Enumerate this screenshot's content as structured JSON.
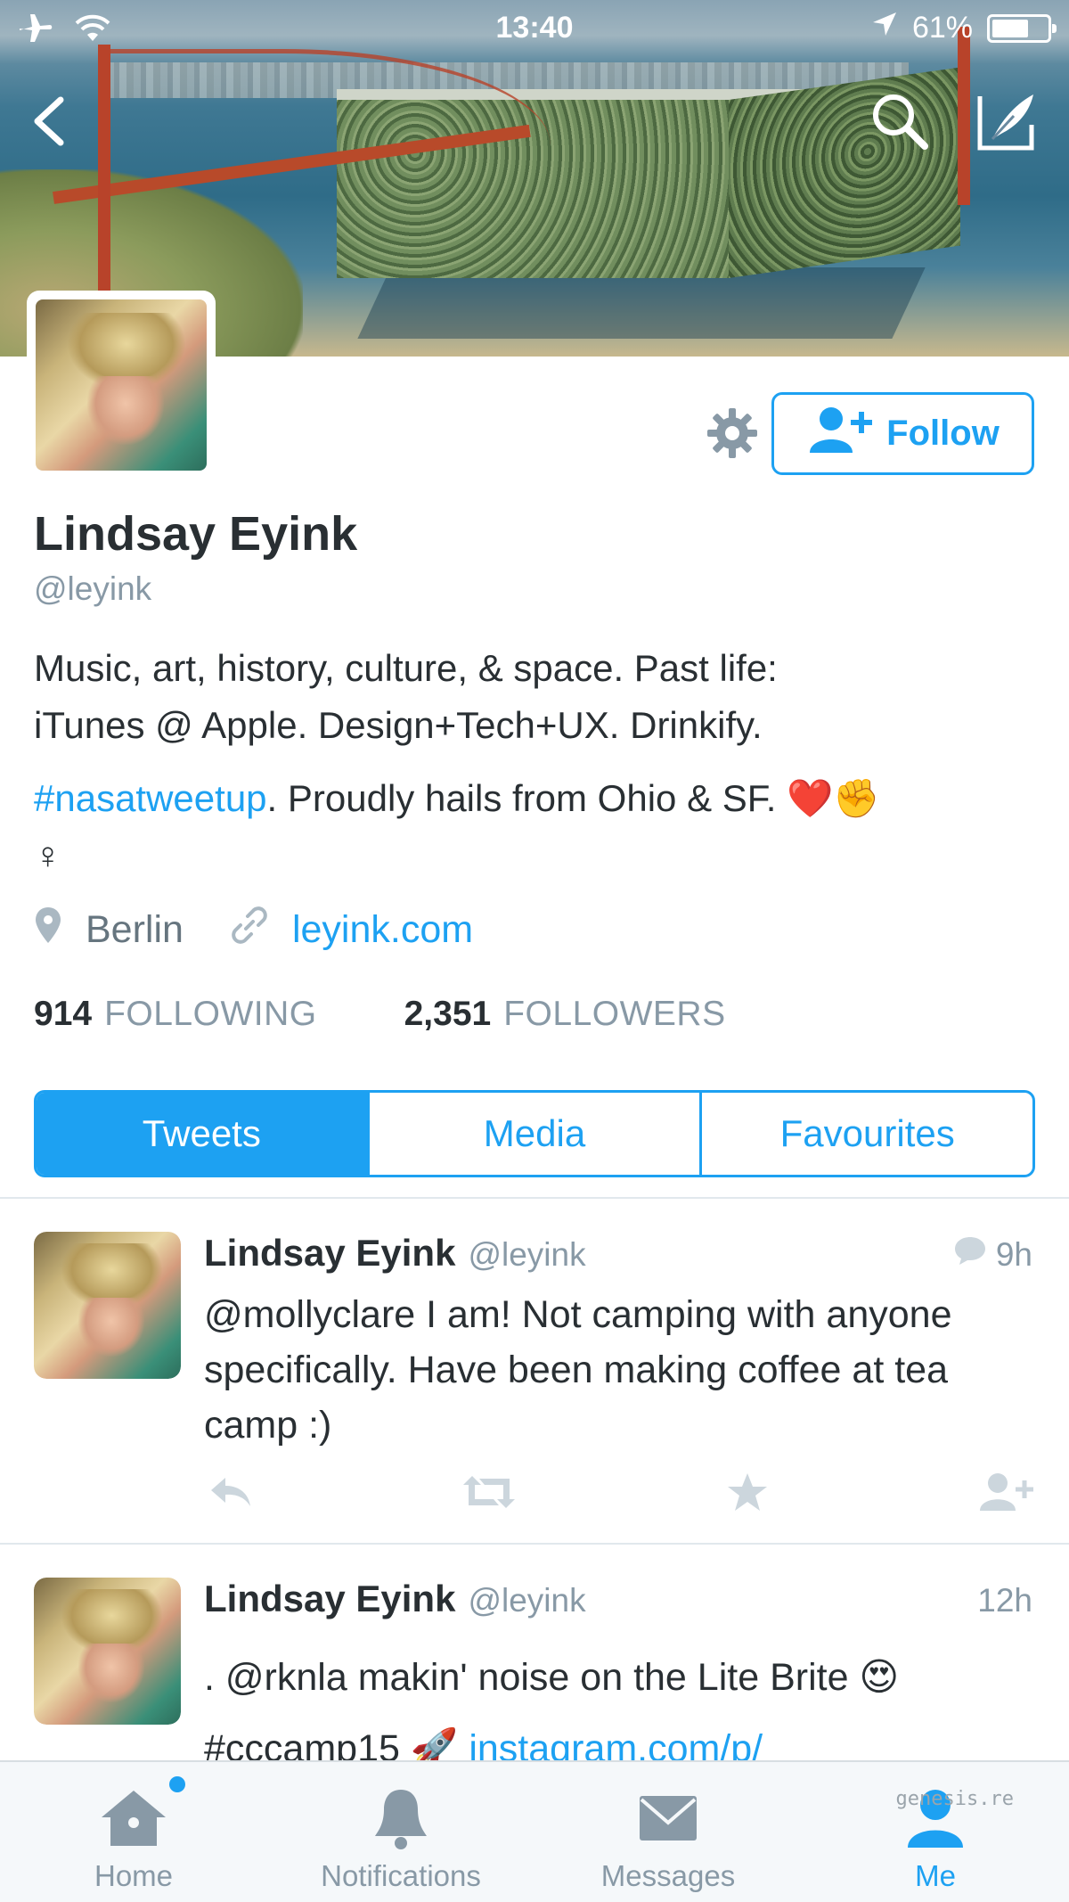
{
  "status_bar": {
    "time": "13:40",
    "battery": "61%",
    "battery_level": 0.61
  },
  "profile": {
    "name": "Lindsay Eyink",
    "handle": "@leyink",
    "bio_line1": "Music, art, history, culture, & space. Past life:",
    "bio_line2": "iTunes @ Apple. Design+Tech+UX. Drinkify.",
    "bio_hashtag": "#nasatweetup",
    "bio_line3_rest": ". Proudly hails from Ohio & SF. ❤️✊",
    "bio_line4": "♀",
    "location": "Berlin",
    "website": "leyink.com",
    "following_count": "914",
    "following_label": "FOLLOWING",
    "followers_count": "2,351",
    "followers_label": "FOLLOWERS",
    "follow_label": "Follow"
  },
  "tabs": [
    "Tweets",
    "Media",
    "Favourites"
  ],
  "active_tab": "Tweets",
  "tweets": [
    {
      "name": "Lindsay Eyink",
      "handle": "@leyink",
      "time": "9h",
      "text": "@mollyclare I am! Not camping with anyone specifically. Have been making coffee at tea camp :)"
    },
    {
      "name": "Lindsay Eyink",
      "handle": "@leyink",
      "time": "12h",
      "text_line1": ". @rknla makin' noise on the Lite Brite 😍",
      "text_line2": "#cccamp15 🚀",
      "link": "instagram.com/p/"
    }
  ],
  "tab_bar": [
    {
      "label": "Home",
      "icon": "home-icon"
    },
    {
      "label": "Notifications",
      "icon": "bell-icon"
    },
    {
      "label": "Messages",
      "icon": "envelope-icon"
    },
    {
      "label": "Me",
      "icon": "person-icon"
    }
  ],
  "watermark": "genesis.re",
  "colors": {
    "accent": "#1da1f2",
    "text": "#292f33",
    "muted": "#8899a6",
    "heart": "#e0245e"
  }
}
